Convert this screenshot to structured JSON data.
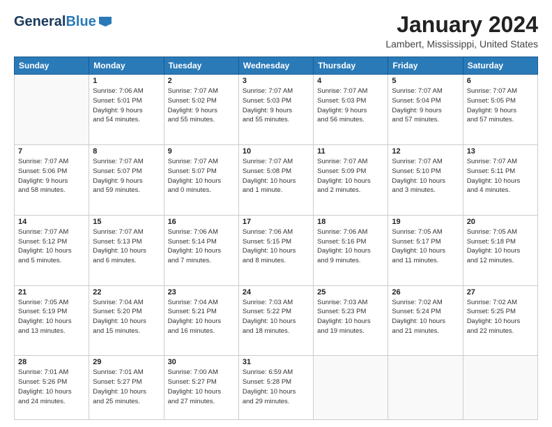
{
  "logo": {
    "general": "General",
    "blue": "Blue"
  },
  "header": {
    "month": "January 2024",
    "location": "Lambert, Mississippi, United States"
  },
  "days": [
    "Sunday",
    "Monday",
    "Tuesday",
    "Wednesday",
    "Thursday",
    "Friday",
    "Saturday"
  ],
  "weeks": [
    [
      {
        "day": "",
        "info": ""
      },
      {
        "day": "1",
        "info": "Sunrise: 7:06 AM\nSunset: 5:01 PM\nDaylight: 9 hours\nand 54 minutes."
      },
      {
        "day": "2",
        "info": "Sunrise: 7:07 AM\nSunset: 5:02 PM\nDaylight: 9 hours\nand 55 minutes."
      },
      {
        "day": "3",
        "info": "Sunrise: 7:07 AM\nSunset: 5:03 PM\nDaylight: 9 hours\nand 55 minutes."
      },
      {
        "day": "4",
        "info": "Sunrise: 7:07 AM\nSunset: 5:03 PM\nDaylight: 9 hours\nand 56 minutes."
      },
      {
        "day": "5",
        "info": "Sunrise: 7:07 AM\nSunset: 5:04 PM\nDaylight: 9 hours\nand 57 minutes."
      },
      {
        "day": "6",
        "info": "Sunrise: 7:07 AM\nSunset: 5:05 PM\nDaylight: 9 hours\nand 57 minutes."
      }
    ],
    [
      {
        "day": "7",
        "info": "Sunrise: 7:07 AM\nSunset: 5:06 PM\nDaylight: 9 hours\nand 58 minutes."
      },
      {
        "day": "8",
        "info": "Sunrise: 7:07 AM\nSunset: 5:07 PM\nDaylight: 9 hours\nand 59 minutes."
      },
      {
        "day": "9",
        "info": "Sunrise: 7:07 AM\nSunset: 5:07 PM\nDaylight: 10 hours\nand 0 minutes."
      },
      {
        "day": "10",
        "info": "Sunrise: 7:07 AM\nSunset: 5:08 PM\nDaylight: 10 hours\nand 1 minute."
      },
      {
        "day": "11",
        "info": "Sunrise: 7:07 AM\nSunset: 5:09 PM\nDaylight: 10 hours\nand 2 minutes."
      },
      {
        "day": "12",
        "info": "Sunrise: 7:07 AM\nSunset: 5:10 PM\nDaylight: 10 hours\nand 3 minutes."
      },
      {
        "day": "13",
        "info": "Sunrise: 7:07 AM\nSunset: 5:11 PM\nDaylight: 10 hours\nand 4 minutes."
      }
    ],
    [
      {
        "day": "14",
        "info": "Sunrise: 7:07 AM\nSunset: 5:12 PM\nDaylight: 10 hours\nand 5 minutes."
      },
      {
        "day": "15",
        "info": "Sunrise: 7:07 AM\nSunset: 5:13 PM\nDaylight: 10 hours\nand 6 minutes."
      },
      {
        "day": "16",
        "info": "Sunrise: 7:06 AM\nSunset: 5:14 PM\nDaylight: 10 hours\nand 7 minutes."
      },
      {
        "day": "17",
        "info": "Sunrise: 7:06 AM\nSunset: 5:15 PM\nDaylight: 10 hours\nand 8 minutes."
      },
      {
        "day": "18",
        "info": "Sunrise: 7:06 AM\nSunset: 5:16 PM\nDaylight: 10 hours\nand 9 minutes."
      },
      {
        "day": "19",
        "info": "Sunrise: 7:05 AM\nSunset: 5:17 PM\nDaylight: 10 hours\nand 11 minutes."
      },
      {
        "day": "20",
        "info": "Sunrise: 7:05 AM\nSunset: 5:18 PM\nDaylight: 10 hours\nand 12 minutes."
      }
    ],
    [
      {
        "day": "21",
        "info": "Sunrise: 7:05 AM\nSunset: 5:19 PM\nDaylight: 10 hours\nand 13 minutes."
      },
      {
        "day": "22",
        "info": "Sunrise: 7:04 AM\nSunset: 5:20 PM\nDaylight: 10 hours\nand 15 minutes."
      },
      {
        "day": "23",
        "info": "Sunrise: 7:04 AM\nSunset: 5:21 PM\nDaylight: 10 hours\nand 16 minutes."
      },
      {
        "day": "24",
        "info": "Sunrise: 7:03 AM\nSunset: 5:22 PM\nDaylight: 10 hours\nand 18 minutes."
      },
      {
        "day": "25",
        "info": "Sunrise: 7:03 AM\nSunset: 5:23 PM\nDaylight: 10 hours\nand 19 minutes."
      },
      {
        "day": "26",
        "info": "Sunrise: 7:02 AM\nSunset: 5:24 PM\nDaylight: 10 hours\nand 21 minutes."
      },
      {
        "day": "27",
        "info": "Sunrise: 7:02 AM\nSunset: 5:25 PM\nDaylight: 10 hours\nand 22 minutes."
      }
    ],
    [
      {
        "day": "28",
        "info": "Sunrise: 7:01 AM\nSunset: 5:26 PM\nDaylight: 10 hours\nand 24 minutes."
      },
      {
        "day": "29",
        "info": "Sunrise: 7:01 AM\nSunset: 5:27 PM\nDaylight: 10 hours\nand 25 minutes."
      },
      {
        "day": "30",
        "info": "Sunrise: 7:00 AM\nSunset: 5:27 PM\nDaylight: 10 hours\nand 27 minutes."
      },
      {
        "day": "31",
        "info": "Sunrise: 6:59 AM\nSunset: 5:28 PM\nDaylight: 10 hours\nand 29 minutes."
      },
      {
        "day": "",
        "info": ""
      },
      {
        "day": "",
        "info": ""
      },
      {
        "day": "",
        "info": ""
      }
    ]
  ]
}
